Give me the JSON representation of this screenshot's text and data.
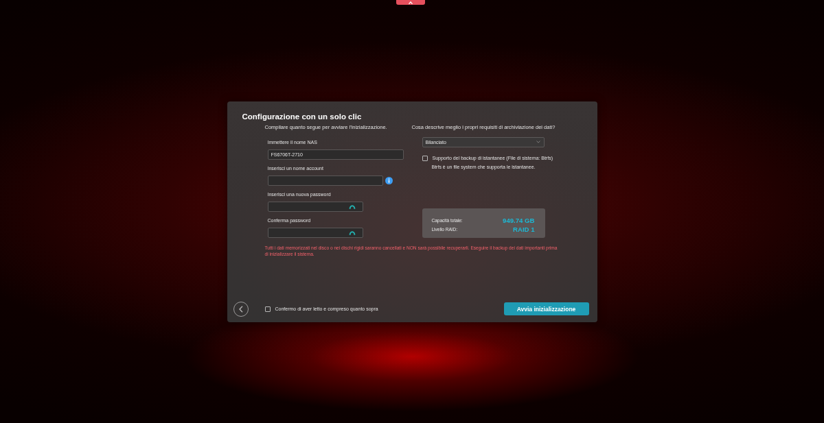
{
  "dialog": {
    "title": "Configurazione con un solo clic",
    "account_form": {
      "instruction": "Compilare quanto segue per avviare l'inizializzazione.",
      "fields": [
        {
          "kind": "text",
          "label": "Immettere il nome NAS",
          "value": "FS6706T-2710"
        },
        {
          "kind": "text",
          "label": "Inserisci un nome account",
          "info": true
        },
        {
          "kind": "password",
          "label": "Inserisci una nuova password"
        },
        {
          "kind": "password",
          "label": "Conferma password"
        }
      ]
    },
    "storage": {
      "question": "Cosa descrive meglio i propri requisiti di archiviazione dei dati?",
      "profile": {
        "value": "Bilanciato"
      },
      "options": [
        {
          "label": "Supporto del backup di istantanee (File di sistema: Btrfs)",
          "checked": false
        }
      ],
      "note": "Btrfs è un file system che supporta le istantanee.",
      "summary": [
        {
          "label": "Capacità totale:",
          "value": "949.74 GB"
        },
        {
          "label": "Livello RAID:",
          "value": "RAID 1"
        }
      ]
    },
    "warning": "Tutti i dati memorizzati nel disco o nei dischi rigidi saranno cancellati e NON sarà possibile recuperarli. Eseguire il backup dei dati importanti prima di inizializzare il sistema.",
    "footer": {
      "confirm": {
        "label": "Confermo di aver letto e compreso quanto sopra",
        "checked": false
      },
      "primary_button": "Avvia inizializzazione"
    }
  }
}
